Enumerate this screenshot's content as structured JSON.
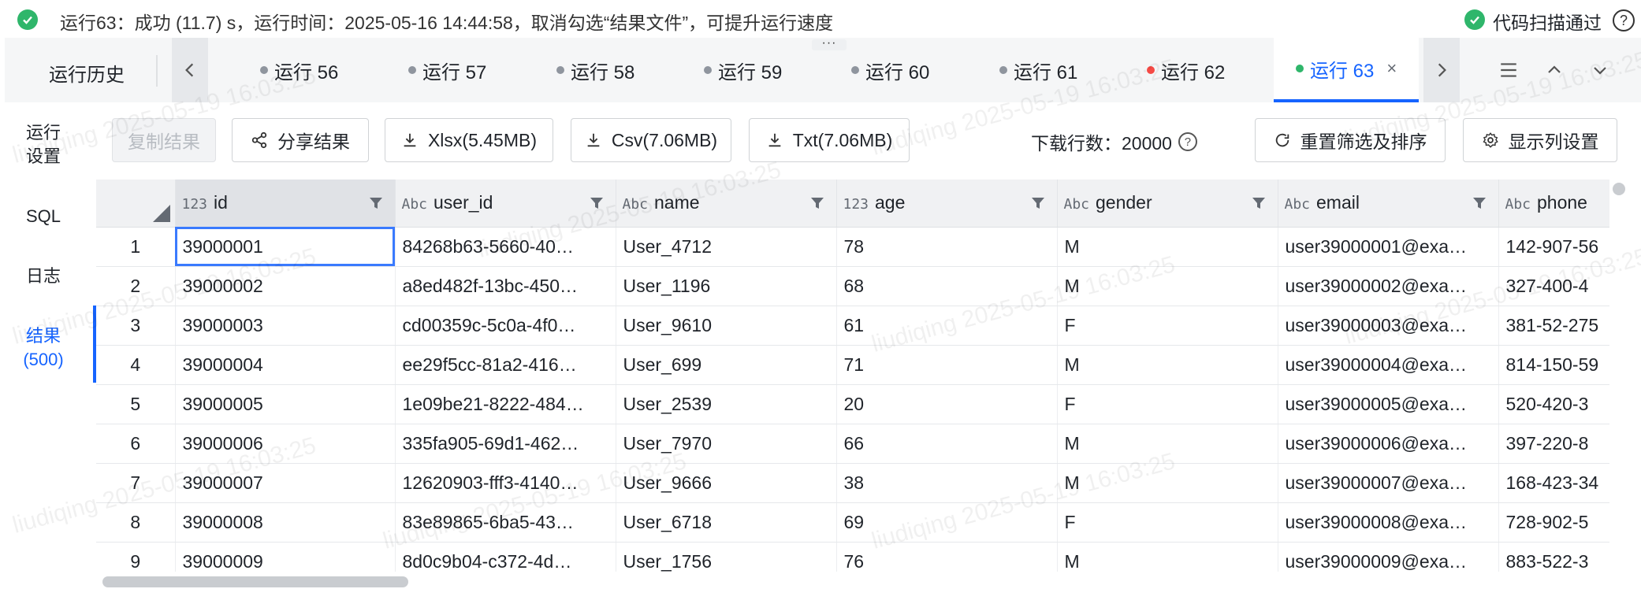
{
  "status": {
    "text": "运行63：成功 (11.7) s，运行时间：2025-05-16 14:44:58，取消勾选“结果文件”，可提升运行速度",
    "scan_label": "代码扫描通过",
    "help_glyph": "?"
  },
  "drag_handle": "···",
  "history": {
    "label": "运行历史"
  },
  "tabs": [
    {
      "label": "运行 56",
      "status": "gray"
    },
    {
      "label": "运行 57",
      "status": "gray"
    },
    {
      "label": "运行 58",
      "status": "gray"
    },
    {
      "label": "运行 59",
      "status": "gray"
    },
    {
      "label": "运行 60",
      "status": "gray"
    },
    {
      "label": "运行 61",
      "status": "gray"
    },
    {
      "label": "运行 62",
      "status": "red"
    },
    {
      "label": "运行 63",
      "status": "green",
      "active": true,
      "close": "×"
    }
  ],
  "nav": {
    "settings_line1": "运行",
    "settings_line2": "设置",
    "sql": "SQL",
    "log": "日志",
    "result_line1": "结果",
    "result_line2": "(500)"
  },
  "toolbar": {
    "copy": "复制结果",
    "share": "分享结果",
    "xlsx": "Xlsx(5.45MB)",
    "csv": "Csv(7.06MB)",
    "txt": "Txt(7.06MB)",
    "download_rows": "下载行数：20000",
    "reset": "重置筛选及排序",
    "columns": "显示列设置"
  },
  "columns": [
    {
      "type": "123",
      "name": "id"
    },
    {
      "type": "Abc",
      "name": "user_id"
    },
    {
      "type": "Abc",
      "name": "name"
    },
    {
      "type": "123",
      "name": "age"
    },
    {
      "type": "Abc",
      "name": "gender"
    },
    {
      "type": "Abc",
      "name": "email"
    },
    {
      "type": "Abc",
      "name": "phone"
    }
  ],
  "rows": [
    [
      "1",
      "39000001",
      "84268b63-5660-40…",
      "User_4712",
      "78",
      "M",
      "user39000001@exa…",
      "142-907-56"
    ],
    [
      "2",
      "39000002",
      "a8ed482f-13bc-450…",
      "User_1196",
      "68",
      "M",
      "user39000002@exa…",
      "327-400-4"
    ],
    [
      "3",
      "39000003",
      "cd00359c-5c0a-4f0…",
      "User_9610",
      "61",
      "F",
      "user39000003@exa…",
      "381-52-275"
    ],
    [
      "4",
      "39000004",
      "ee29f5cc-81a2-416…",
      "User_699",
      "71",
      "M",
      "user39000004@exa…",
      "814-150-59"
    ],
    [
      "5",
      "39000005",
      "1e09be21-8222-484…",
      "User_2539",
      "20",
      "F",
      "user39000005@exa…",
      "520-420-3"
    ],
    [
      "6",
      "39000006",
      "335fa905-69d1-462…",
      "User_7970",
      "66",
      "M",
      "user39000006@exa…",
      "397-220-8"
    ],
    [
      "7",
      "39000007",
      "12620903-fff3-4140…",
      "User_9666",
      "38",
      "M",
      "user39000007@exa…",
      "168-423-34"
    ],
    [
      "8",
      "39000008",
      "83e89865-6ba5-43…",
      "User_6718",
      "69",
      "F",
      "user39000008@exa…",
      "728-902-5"
    ],
    [
      "9",
      "39000009",
      "8d0c9b04-c372-4d…",
      "User_1756",
      "76",
      "M",
      "user39000009@exa…",
      "883-522-3"
    ]
  ],
  "watermark": "liudiqing 2025-05-19 16:03:25",
  "colors": {
    "accent": "#1664ff",
    "success": "#2fb66b",
    "error": "#f54a45"
  }
}
